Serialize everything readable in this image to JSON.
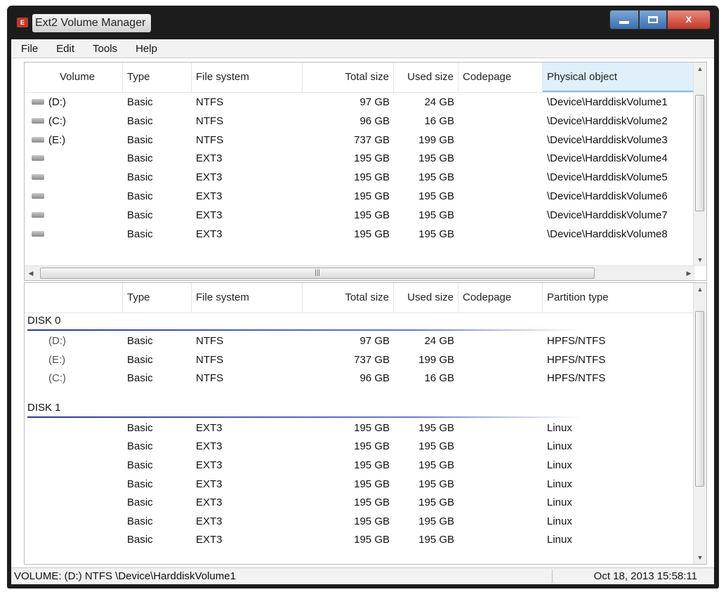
{
  "window": {
    "title": "Ext2 Volume Manager",
    "close_glyph": "x"
  },
  "menu": [
    "File",
    "Edit",
    "Tools",
    "Help"
  ],
  "volumes": {
    "headers": [
      "Volume",
      "Type",
      "File system",
      "Total size",
      "Used size",
      "Codepage",
      "Physical object"
    ],
    "rows": [
      {
        "volume": "(D:)",
        "type": "Basic",
        "fs": "NTFS",
        "total": "97 GB",
        "used": "24 GB",
        "codepage": "",
        "physical": "\\Device\\HarddiskVolume1"
      },
      {
        "volume": "(C:)",
        "type": "Basic",
        "fs": "NTFS",
        "total": "96 GB",
        "used": "16 GB",
        "codepage": "",
        "physical": "\\Device\\HarddiskVolume2"
      },
      {
        "volume": "(E:)",
        "type": "Basic",
        "fs": "NTFS",
        "total": "737 GB",
        "used": "199 GB",
        "codepage": "",
        "physical": "\\Device\\HarddiskVolume3"
      },
      {
        "volume": "",
        "type": "Basic",
        "fs": "EXT3",
        "total": "195 GB",
        "used": "195 GB",
        "codepage": "",
        "physical": "\\Device\\HarddiskVolume4"
      },
      {
        "volume": "",
        "type": "Basic",
        "fs": "EXT3",
        "total": "195 GB",
        "used": "195 GB",
        "codepage": "",
        "physical": "\\Device\\HarddiskVolume5"
      },
      {
        "volume": "",
        "type": "Basic",
        "fs": "EXT3",
        "total": "195 GB",
        "used": "195 GB",
        "codepage": "",
        "physical": "\\Device\\HarddiskVolume6"
      },
      {
        "volume": "",
        "type": "Basic",
        "fs": "EXT3",
        "total": "195 GB",
        "used": "195 GB",
        "codepage": "",
        "physical": "\\Device\\HarddiskVolume7"
      },
      {
        "volume": "",
        "type": "Basic",
        "fs": "EXT3",
        "total": "195 GB",
        "used": "195 GB",
        "codepage": "",
        "physical": "\\Device\\HarddiskVolume8"
      }
    ]
  },
  "disks": {
    "headers": [
      "",
      "Type",
      "File system",
      "Total size",
      "Used size",
      "Codepage",
      "Partition type"
    ],
    "groups": [
      {
        "label": "DISK 0",
        "rows": [
          {
            "volume": "(D:)",
            "type": "Basic",
            "fs": "NTFS",
            "total": "97 GB",
            "used": "24 GB",
            "partition": "HPFS/NTFS"
          },
          {
            "volume": "(E:)",
            "type": "Basic",
            "fs": "NTFS",
            "total": "737 GB",
            "used": "199 GB",
            "partition": "HPFS/NTFS"
          },
          {
            "volume": "(C:)",
            "type": "Basic",
            "fs": "NTFS",
            "total": "96 GB",
            "used": "16 GB",
            "partition": "HPFS/NTFS"
          }
        ]
      },
      {
        "label": "DISK 1",
        "rows": [
          {
            "volume": "",
            "type": "Basic",
            "fs": "EXT3",
            "total": "195 GB",
            "used": "195 GB",
            "partition": "Linux"
          },
          {
            "volume": "",
            "type": "Basic",
            "fs": "EXT3",
            "total": "195 GB",
            "used": "195 GB",
            "partition": "Linux"
          },
          {
            "volume": "",
            "type": "Basic",
            "fs": "EXT3",
            "total": "195 GB",
            "used": "195 GB",
            "partition": "Linux"
          },
          {
            "volume": "",
            "type": "Basic",
            "fs": "EXT3",
            "total": "195 GB",
            "used": "195 GB",
            "partition": "Linux"
          },
          {
            "volume": "",
            "type": "Basic",
            "fs": "EXT3",
            "total": "195 GB",
            "used": "195 GB",
            "partition": "Linux"
          },
          {
            "volume": "",
            "type": "Basic",
            "fs": "EXT3",
            "total": "195 GB",
            "used": "195 GB",
            "partition": "Linux"
          },
          {
            "volume": "",
            "type": "Basic",
            "fs": "EXT3",
            "total": "195 GB",
            "used": "195 GB",
            "partition": "Linux"
          }
        ]
      }
    ]
  },
  "status": {
    "left": "VOLUME: (D:) NTFS \\Device\\HarddiskVolume1",
    "right": "Oct 18, 2013 15:58:11"
  },
  "colors": {
    "active_header": "#dff0fb",
    "group_line": "#2a3a8a",
    "close_button": "#c0392b"
  }
}
